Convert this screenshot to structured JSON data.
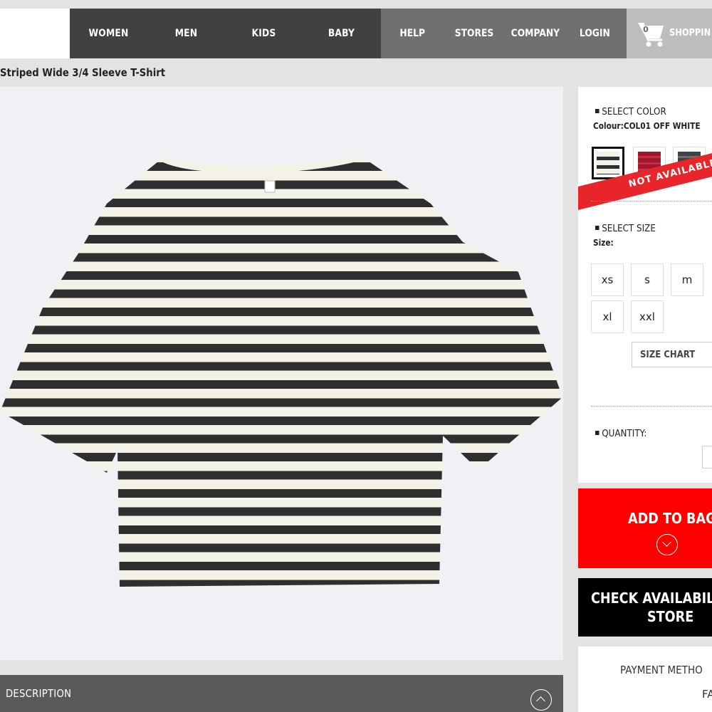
{
  "header": {
    "nav_main": [
      "WOMEN",
      "MEN",
      "KIDS",
      "BABY"
    ],
    "nav_sub": [
      "HELP",
      "STORES",
      "COMPANY",
      "LOGIN"
    ],
    "cart_count": "0",
    "cart_label": "SHOPPIN",
    "cart_icon": "shopping-cart-icon"
  },
  "product": {
    "title": "Striped Wide 3/4 Sleeve T-Shirt"
  },
  "color": {
    "section_label": "SELECT COLOR",
    "current": "Colour:COL01 OFF WHITE",
    "swatches": [
      {
        "name": "off-white-stripe",
        "colors": [
          "#f4f1e6",
          "#2f2f2f"
        ],
        "selected": true
      },
      {
        "name": "red",
        "colors": [
          "#a0172e",
          "#c43048"
        ],
        "selected": false
      },
      {
        "name": "grey",
        "colors": [
          "#3f4346",
          "#6c7073"
        ],
        "selected": false
      }
    ],
    "not_available": "NOT AVAILABLE"
  },
  "size": {
    "section_label": "SELECT SIZE",
    "current": "Size:",
    "options": [
      "xs",
      "s",
      "m",
      "xl",
      "xxl"
    ],
    "chart_label": "SIZE CHART"
  },
  "quantity": {
    "section_label": "QUANTITY:"
  },
  "actions": {
    "add_to_bag": "ADD TO BAG",
    "check_store_line1": "CHECK AVAILABILI",
    "check_store_line2": "STORE"
  },
  "payment": {
    "label": "PAYMENT METHO",
    "fa": "FA"
  },
  "description": {
    "label": "DESCRIPTION"
  },
  "colors": {
    "header_dark": "#414141",
    "header_mid": "#707070",
    "header_light": "#bdbdbd",
    "accent_red": "#ff0000",
    "stripe_dark": "#2f2f2f",
    "stripe_light": "#f4f1e6"
  }
}
